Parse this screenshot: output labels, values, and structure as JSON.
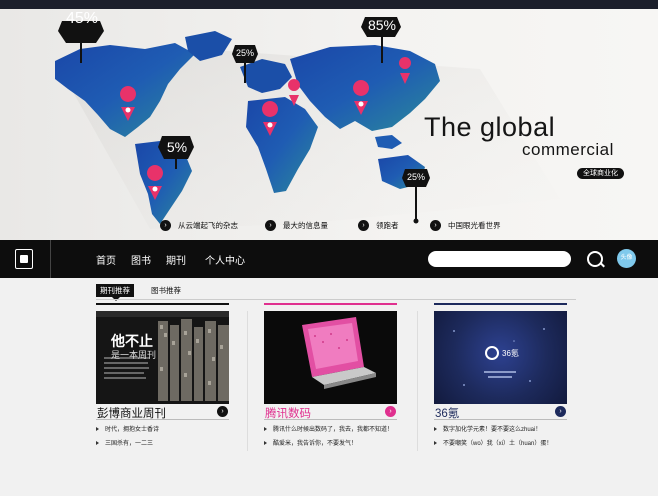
{
  "hero": {
    "title": "The global",
    "subtitle": "commercial",
    "badge": "全球商业化",
    "percentages": [
      "45%",
      "25%",
      "85%",
      "5%",
      "25%"
    ],
    "features": [
      {
        "arrow": "›",
        "label": "从云端起飞的杂志"
      },
      {
        "arrow": "›",
        "label": "最大的信息量"
      },
      {
        "arrow": "›",
        "label": "领跑者"
      },
      {
        "arrow": "›",
        "label": "中国眼光看世界"
      }
    ]
  },
  "nav": {
    "items": [
      "首页",
      "图书",
      "期刊",
      "个人中心"
    ],
    "search_placeholder": "",
    "avatar_text": "头像"
  },
  "tabs": {
    "active": "期刊推荐",
    "inactive": "图书推荐"
  },
  "cards": [
    {
      "name": "彭博商业周刊",
      "accent": "#111111",
      "cover_headline": "他不止",
      "cover_sub": "是一本周刊",
      "lines": [
        "时代，拥抱女士香诗",
        "三国杀有，一二三"
      ]
    },
    {
      "name": "腾讯数码",
      "accent": "#e0308f",
      "lines": [
        "腾讯什么时候出数码了，我去，我都不知道！",
        "酷爱米，我告诉你，不要发气！"
      ]
    },
    {
      "name": "36氪",
      "accent": "#1d2a5c",
      "cover_logo": "36氪",
      "lines": [
        "数字加化学元素！要不要这么zhuai！",
        "不要嘲笑（wo）我（xi）土（huan）蛋！"
      ]
    }
  ],
  "colors": {
    "nav_bg": "#0d0d0d",
    "pin": "#e8326a",
    "avatar": "#7fc9ec",
    "accent_pink": "#e0308f",
    "accent_navy": "#1d2a5c"
  }
}
